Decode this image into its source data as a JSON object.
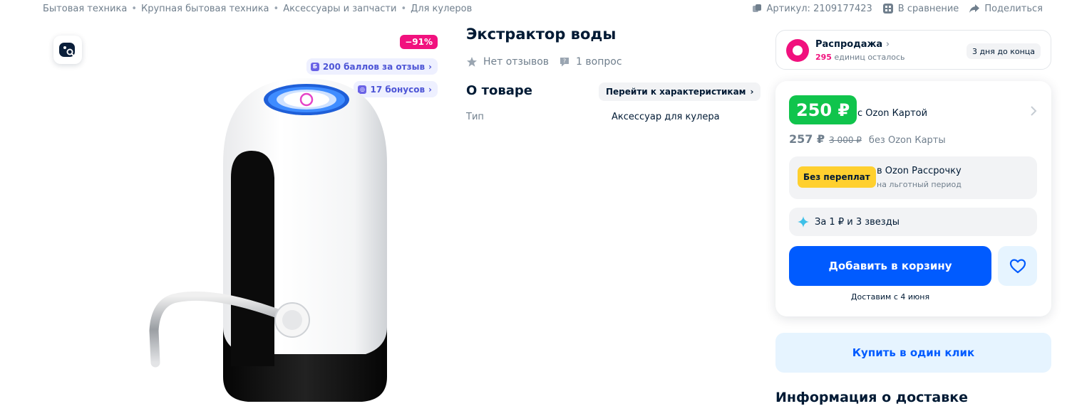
{
  "breadcrumbs": [
    "Бытовая техника",
    "Крупная бытовая техника",
    "Аксессуары и запчасти",
    "Для кулеров"
  ],
  "meta": {
    "article": "Артикул: 2109177423",
    "compare": "В сравнение",
    "share": "Поделиться"
  },
  "gallery": {
    "discount_badge": "−91%",
    "reviews_points": "200 баллов за отзыв",
    "bonus": "17 бонусов"
  },
  "product": {
    "title": "Экстрактор воды",
    "reviews": "Нет отзывов",
    "questions": "1 вопрос",
    "about_heading": "О товаре",
    "to_specs": "Перейти к характеристикам",
    "specs": [
      {
        "name": "Тип",
        "value": "Аксессуар для кулера"
      }
    ]
  },
  "sale": {
    "title": "Распродажа",
    "units_count": "295",
    "units_label": "единиц осталось",
    "deadline": "3 дня до конца",
    "accent_color": "#f1117e"
  },
  "price": {
    "card_price": "250 ₽",
    "card_note": "с Ozon Картой",
    "regular_price": "257 ₽",
    "old_price": "3 000 ₽",
    "regular_note": "без Ozon Карты",
    "green_color": "#10c44c"
  },
  "installment": {
    "badge": "Без переплат",
    "title": "в Ozon Рассрочку",
    "subtitle": "на льготный период"
  },
  "stars_offer": "За 1 ₽ и 3 звезды",
  "actions": {
    "add_to_cart": "Добавить в корзину",
    "delivery": "Доставим с 4 июня",
    "buy_one_click": "Купить в один клик",
    "primary_color": "#005bff"
  },
  "delivery_section_title": "Информация о доставке"
}
